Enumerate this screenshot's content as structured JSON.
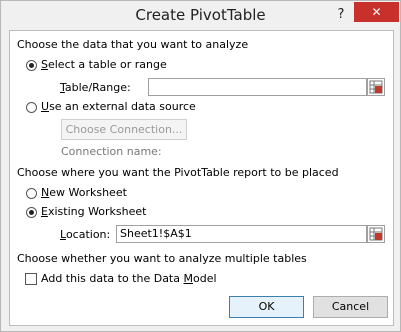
{
  "window": {
    "title": "Create PivotTable",
    "help_glyph": "?",
    "close_glyph": "✕"
  },
  "section_data": {
    "heading": "Choose the data that you want to analyze",
    "select_table_option": {
      "label": "Select a table or range",
      "checked": true
    },
    "table_range": {
      "label": "Table/Range:",
      "value": ""
    },
    "external_source_option": {
      "label": "Use an external data source",
      "checked": false
    },
    "choose_connection_button": "Choose Connection...",
    "connection_name_label": "Connection name:"
  },
  "section_location": {
    "heading": "Choose where you want the PivotTable report to be placed",
    "new_worksheet_option": {
      "label": "New Worksheet",
      "checked": false
    },
    "existing_worksheet_option": {
      "label": "Existing Worksheet",
      "checked": true
    },
    "location": {
      "label": "Location:",
      "value": "Sheet1!$A$1"
    }
  },
  "section_multiple": {
    "heading": "Choose whether you want to analyze multiple tables",
    "data_model_checkbox": {
      "label": "Add this data to the Data Model",
      "checked": false
    }
  },
  "buttons": {
    "ok": "OK",
    "cancel": "Cancel"
  },
  "colors": {
    "close_button": "#c7302b",
    "default_button_border": "#3c7fb1",
    "refedit_icon_red": "#c0392b"
  }
}
